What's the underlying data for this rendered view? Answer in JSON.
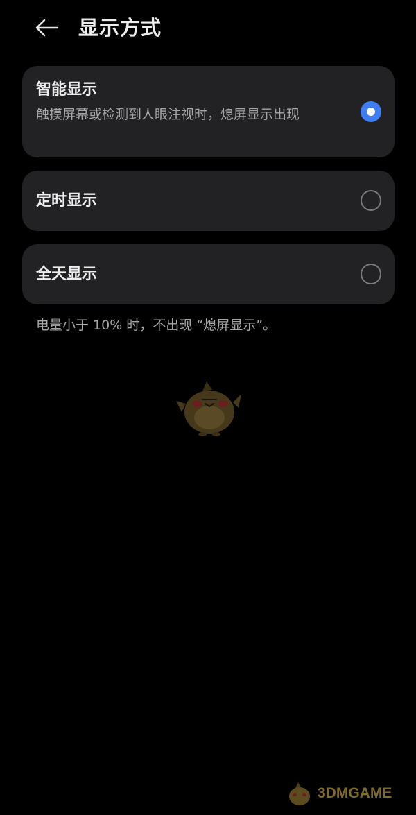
{
  "header": {
    "title": "显示方式",
    "back_icon": "back-arrow-icon"
  },
  "options": [
    {
      "title": "智能显示",
      "description": "触摸屏幕或检测到人眼注视时，熄屏显示出现",
      "selected": true
    },
    {
      "title": "定时显示",
      "selected": false
    },
    {
      "title": "全天显示",
      "selected": false
    }
  ],
  "footnote": "电量小于 10% 时，不出现 “熄屏显示”。",
  "watermark": {
    "text": "3DMGAME"
  },
  "colors": {
    "background": "#000000",
    "card": "#222224",
    "accent": "#3f7ef2",
    "secondary_text": "#a6a6a8"
  }
}
